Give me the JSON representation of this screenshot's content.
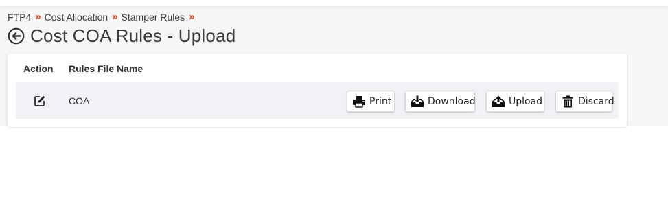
{
  "breadcrumb": {
    "items": [
      "FTP4",
      "Cost Allocation",
      "Stamper Rules"
    ],
    "separator": "»"
  },
  "page": {
    "title": "Cost COA Rules - Upload"
  },
  "table": {
    "columns": [
      "Action",
      "Rules File Name"
    ],
    "rows": [
      {
        "name": "COA"
      }
    ]
  },
  "buttons": {
    "print": "Print",
    "download": "Download",
    "upload": "Upload",
    "discard": "Discard"
  },
  "icons": {
    "back": "arrow-left-circle-icon",
    "edit": "edit-icon",
    "print": "printer-icon",
    "download": "download-tray-icon",
    "upload": "upload-tray-icon",
    "discard": "trash-icon"
  },
  "colors": {
    "breadcrumb_separator": "#d9482b",
    "row_background": "#f0f2f6",
    "page_background": "#f6f6f7"
  }
}
